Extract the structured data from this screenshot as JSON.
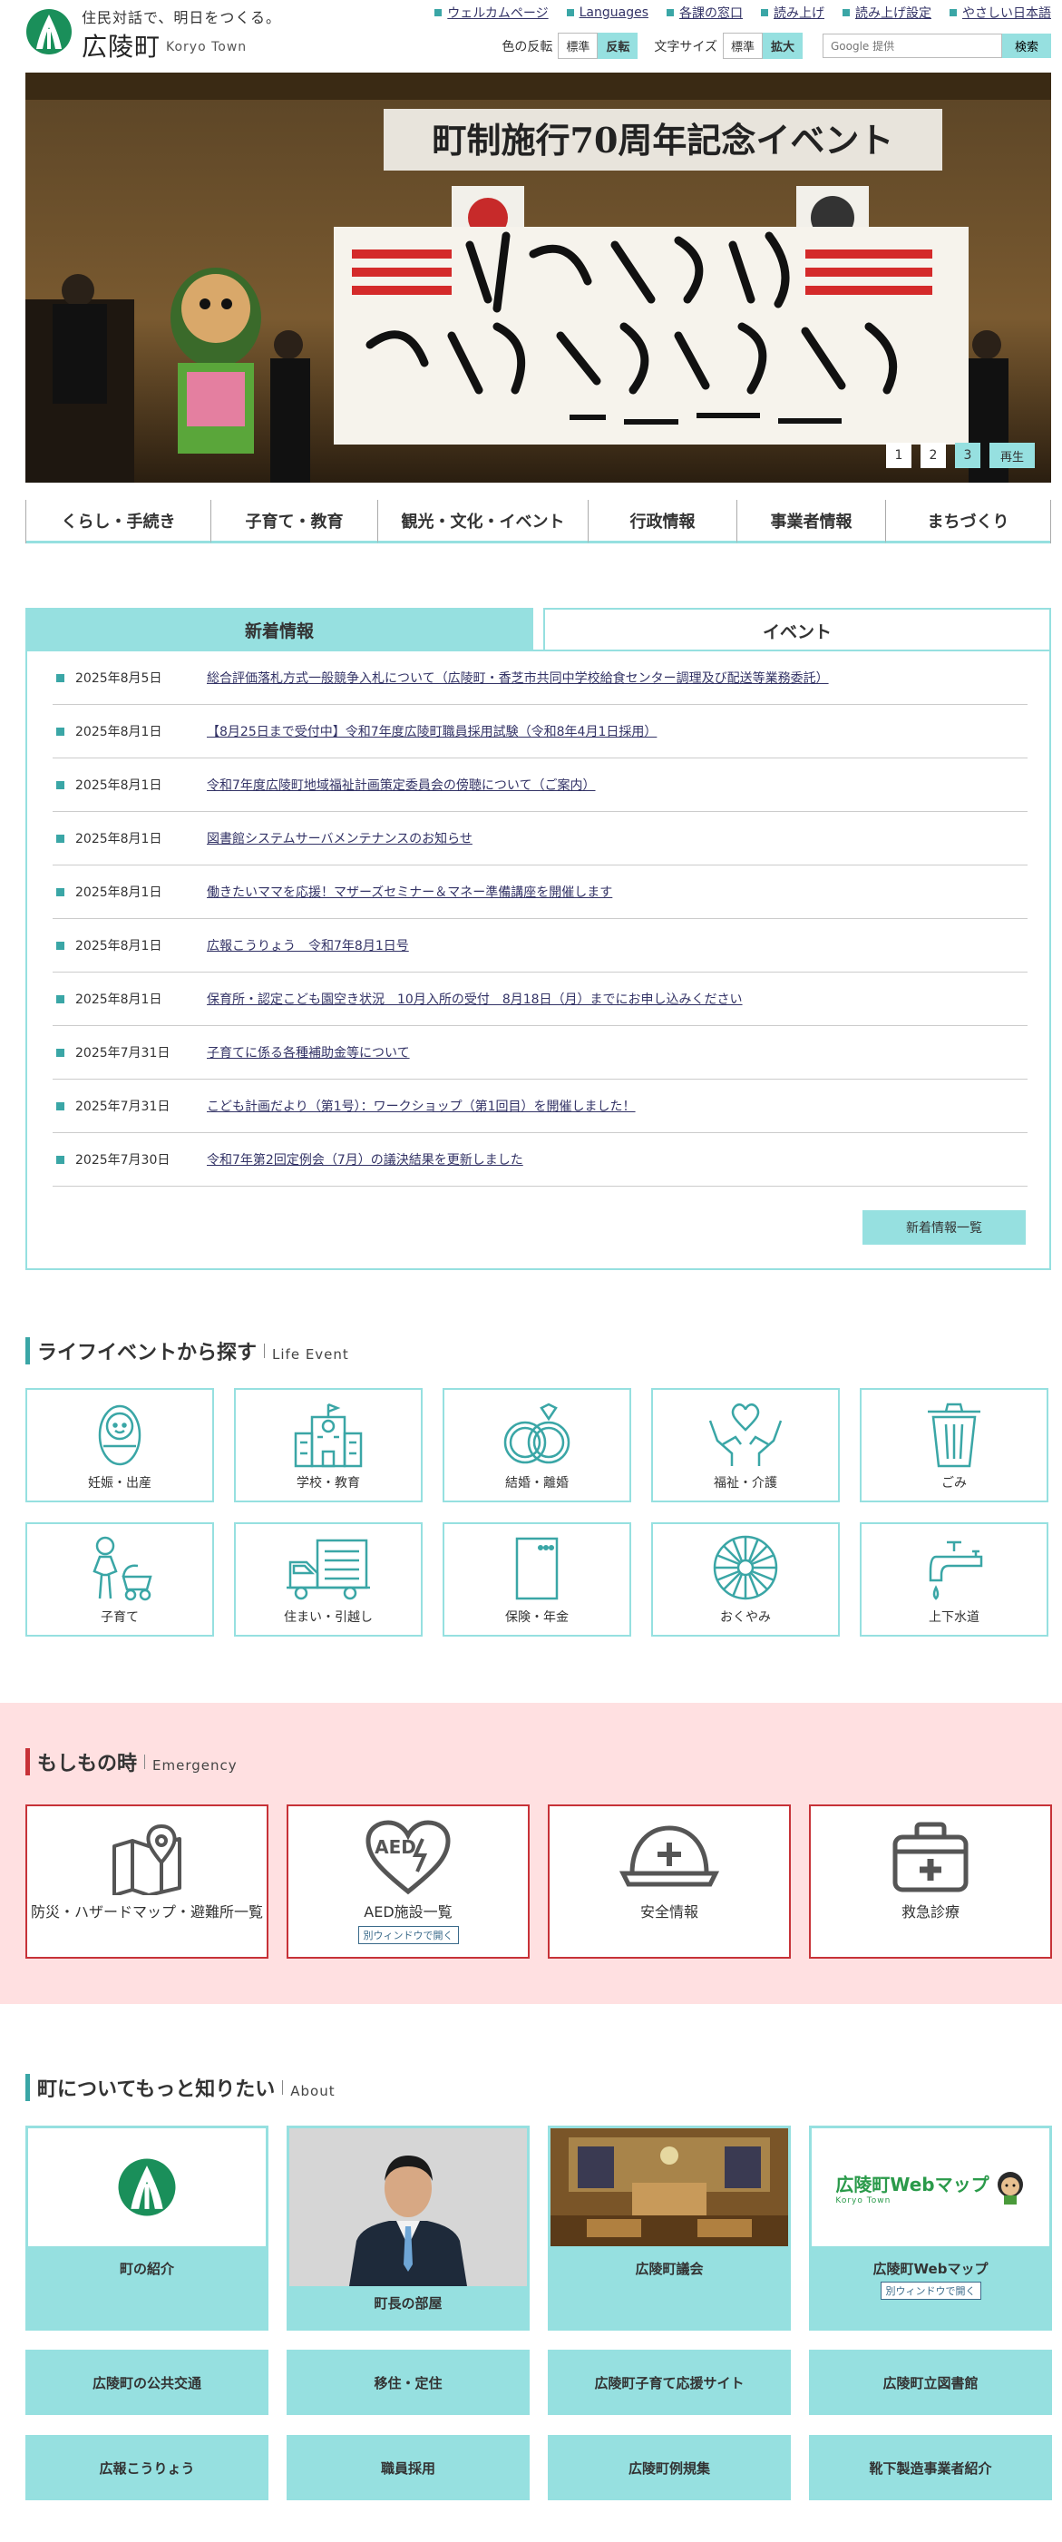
{
  "header": {
    "tagline": "住民対話で、明日をつくる。",
    "town_name": "広陵町",
    "town_name_en": "Koryo Town",
    "top_links": [
      "ウェルカムページ",
      "Languages",
      "各課の窓口",
      "読み上げ",
      "読み上げ設定",
      "やさしい日本語"
    ],
    "color_label": "色の反転",
    "color_normal": "標準",
    "color_invert": "反転",
    "font_label": "文字サイズ",
    "font_normal": "標準",
    "font_large": "拡大",
    "search_placeholder": "Google 提供",
    "search_button": "検索"
  },
  "hero": {
    "banner_text": "町制施行70周年記念イベント",
    "slide_numbers": [
      "1",
      "2",
      "3"
    ],
    "active_slide": 3,
    "play_label": "再生"
  },
  "global_nav": [
    "くらし・手続き",
    "子育て・教育",
    "観光・文化・イベント",
    "行政情報",
    "事業者情報",
    "まちづくり"
  ],
  "news": {
    "tab_news": "新着情報",
    "tab_event": "イベント",
    "items": [
      {
        "date": "2025年8月5日",
        "title": "総合評価落札方式一般競争入札について（広陵町・香芝市共同中学校給食センター調理及び配送等業務委託）"
      },
      {
        "date": "2025年8月1日",
        "title": "【8月25日まで受付中】令和7年度広陵町職員採用試験（令和8年4月1日採用）"
      },
      {
        "date": "2025年8月1日",
        "title": "令和7年度広陵町地域福祉計画策定委員会の傍聴について（ご案内）"
      },
      {
        "date": "2025年8月1日",
        "title": "図書館システムサーバメンテナンスのお知らせ"
      },
      {
        "date": "2025年8月1日",
        "title": "働きたいママを応援！マザーズセミナー＆マネー準備講座を開催します"
      },
      {
        "date": "2025年8月1日",
        "title": "広報こうりょう　令和7年8月1日号"
      },
      {
        "date": "2025年8月1日",
        "title": "保育所・認定こども園空き状況　10月入所の受付　8月18日（月）までにお申し込みください"
      },
      {
        "date": "2025年7月31日",
        "title": "子育てに係る各種補助金等について"
      },
      {
        "date": "2025年7月31日",
        "title": "こども計画だより（第1号）：ワークショップ（第1回目）を開催しました！"
      },
      {
        "date": "2025年7月30日",
        "title": "令和7年第2回定例会（7月）の議決結果を更新しました"
      }
    ],
    "more_label": "新着情報一覧"
  },
  "life_event": {
    "title": "ライフイベントから探す",
    "subtitle": "Life Event",
    "items": [
      {
        "label": "妊娠・出産",
        "icon": "baby-icon"
      },
      {
        "label": "学校・教育",
        "icon": "school-icon"
      },
      {
        "label": "結婚・離婚",
        "icon": "rings-icon"
      },
      {
        "label": "福祉・介護",
        "icon": "heart-hands-icon"
      },
      {
        "label": "ごみ",
        "icon": "trash-icon"
      },
      {
        "label": "子育て",
        "icon": "parent-stroller-icon"
      },
      {
        "label": "住まい・引越し",
        "icon": "moving-truck-icon"
      },
      {
        "label": "保険・年金",
        "icon": "card-icon"
      },
      {
        "label": "おくやみ",
        "icon": "chrysanthemum-icon"
      },
      {
        "label": "上下水道",
        "icon": "faucet-icon"
      }
    ]
  },
  "emergency": {
    "title": "もしもの時",
    "subtitle": "Emergency",
    "items": [
      {
        "label": "防災・ハザードマップ・避難所一覧",
        "icon": "map-pin-icon"
      },
      {
        "label": "AED施設一覧",
        "icon": "aed-heart-icon",
        "badge": "別ウィンドウで開く",
        "icon_text": "AED"
      },
      {
        "label": "安全情報",
        "icon": "helmet-icon"
      },
      {
        "label": "救急診療",
        "icon": "first-aid-kit-icon"
      }
    ]
  },
  "about": {
    "title": "町についてもっと知りたい",
    "subtitle": "About",
    "cards": [
      {
        "label": "町の紹介"
      },
      {
        "label": "町長の部屋"
      },
      {
        "label": "広陵町議会"
      },
      {
        "label": "広陵町Webマップ",
        "badge": "別ウィンドウで開く",
        "logo_text": "広陵町Webマップ",
        "logo_sub": "Koryo Town"
      }
    ],
    "links": [
      "広陵町の公共交通",
      "移住・定住",
      "広陵町子育て応援サイト",
      "広陵町立図書館",
      "広報こうりょう",
      "職員採用",
      "広陵町例規集",
      "靴下製造事業者紹介"
    ]
  },
  "colors": {
    "accent": "#96e0e0",
    "brand_green": "#1a8f5a",
    "emergency_red": "#c73238",
    "emergency_bg": "#ffe0e1",
    "link": "#333366"
  }
}
